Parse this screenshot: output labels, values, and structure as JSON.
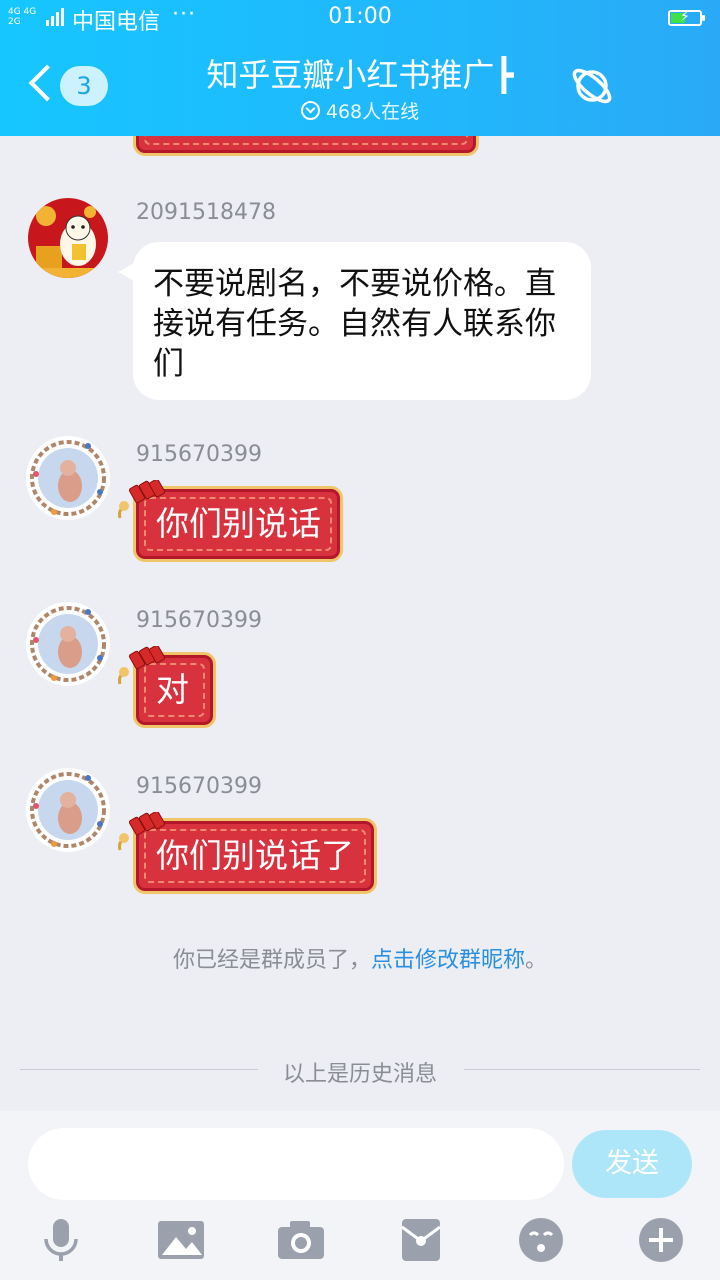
{
  "status_bar": {
    "network_top": "4G 4G",
    "network_bottom": "2G",
    "carrier": "中国电信",
    "more": "···",
    "time": "01:00"
  },
  "header": {
    "back_count": "3",
    "title": "知乎豆瓣小红书推广┣",
    "online": "468人在线"
  },
  "messages": [
    {
      "sender": "2091518478",
      "text": "不要说剧名，不要说价格。直接说有任务。自然有人联系你们"
    },
    {
      "sender": "915670399",
      "text": "你们别说话"
    },
    {
      "sender": "915670399",
      "text": "对"
    },
    {
      "sender": "915670399",
      "text": "你们别说话了"
    }
  ],
  "system": {
    "prefix": "你已经是群成员了，",
    "link": "点击修改群昵称",
    "suffix": "。"
  },
  "history_divider": "以上是历史消息",
  "input": {
    "value": "",
    "send_label": "发送"
  },
  "toolbar_icons": [
    "microphone-icon",
    "image-icon",
    "camera-icon",
    "red-packet-icon",
    "emoji-icon",
    "plus-icon"
  ],
  "colors": {
    "header_blue": "#21b7fb",
    "bubble_red": "#d8323e",
    "bubble_gold": "#f0c56a",
    "link_blue": "#2a8fe0",
    "send_disabled": "#aee6f9"
  }
}
